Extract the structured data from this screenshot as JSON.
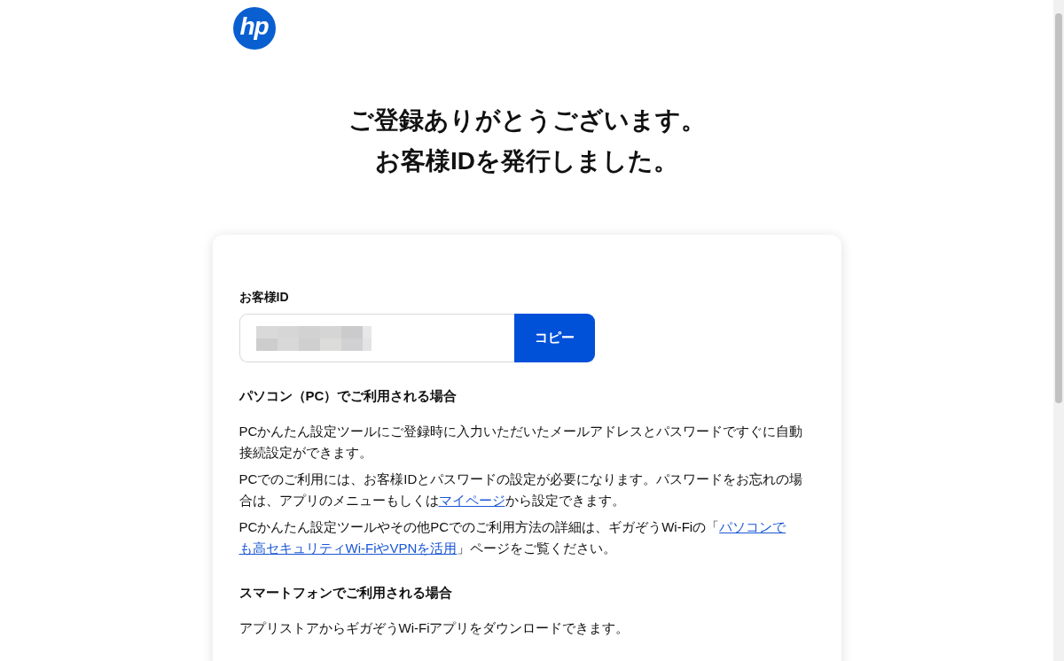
{
  "logo": {
    "text": "hp"
  },
  "heading": [
    "ご登録ありがとうございます。",
    "お客様IDを発行しました。"
  ],
  "id_section": {
    "label": "お客様ID",
    "copy_button": "コピー"
  },
  "sections": [
    {
      "title": "パソコン（PC）でご利用される場合",
      "paragraphs": [
        [
          {
            "kind": "text",
            "text": "PCかんたん設定ツールにご登録時に入力いただいたメールアドレスとパスワードですぐに自動接続設定ができます。"
          }
        ],
        [
          {
            "kind": "text",
            "text": "PCでのご利用には、お客様IDとパスワードの設定が必要になります。パスワードをお忘れの場合は、アプリのメニューもしくは"
          },
          {
            "kind": "link",
            "text": "マイページ"
          },
          {
            "kind": "text",
            "text": "から設定できます。"
          }
        ],
        [
          {
            "kind": "text",
            "text": "PCかんたん設定ツールやその他PCでのご利用方法の詳細は、ギガぞうWi-Fiの「"
          },
          {
            "kind": "link",
            "text": "パソコンで"
          },
          {
            "kind": "link",
            "text": "も高セキュリティWi-FiやVPNを活用"
          },
          {
            "kind": "text",
            "text": "」ページをご覧ください。"
          }
        ]
      ]
    },
    {
      "title": "スマートフォンでご利用される場合",
      "paragraphs": [
        [
          {
            "kind": "text",
            "text": "アプリストアからギガぞうWi-Fiアプリをダウンロードできます。"
          }
        ]
      ]
    }
  ]
}
